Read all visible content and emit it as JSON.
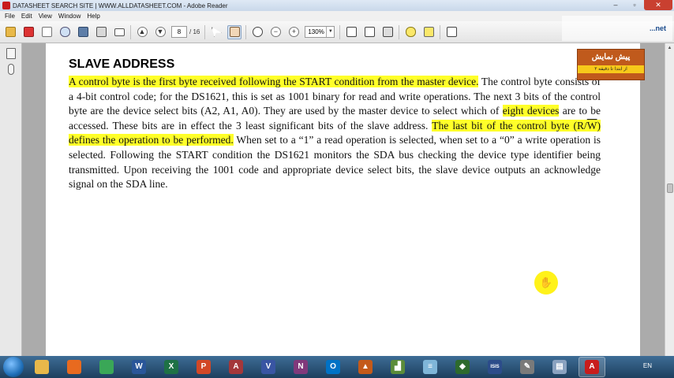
{
  "window": {
    "title": "DATASHEET SEARCH SITE | WWW.ALLDATASHEET.COM - Adobe Reader",
    "minimize": "–",
    "maximize": "▫",
    "close": "✕"
  },
  "menu": [
    "File",
    "Edit",
    "View",
    "Window",
    "Help"
  ],
  "toolbar": {
    "page_current": "8",
    "page_total": "/ 16",
    "zoom": "130%"
  },
  "watermark": {
    "logo_text": "...net",
    "badge_title": "پیش نمایش",
    "badge_sub": "از ابتدا تا دقیقه ۲"
  },
  "document": {
    "heading": "SLAVE ADDRESS",
    "segments": [
      {
        "text": "A control byte is the first byte received following the START condition from the master device.",
        "hl": true
      },
      {
        "text": " The control byte consists of a 4-bit control code; for the DS1621, this is set as 1001 binary for read and write operations.  The next 3 bits of the control byte are the device select bits (A2, A1, A0). They are used by the master device to select which of ",
        "hl": false
      },
      {
        "text": "eight devices",
        "hl": true
      },
      {
        "text": " are to be accessed. These bits are in effect the 3 least significant bits of the slave address. ",
        "hl": false
      },
      {
        "text": "The last bit of the control byte (R/",
        "hl": true
      },
      {
        "text": "W",
        "hl": true,
        "over": true
      },
      {
        "text": ") defines the operation to be performed.",
        "hl": true
      },
      {
        "text": " When set to a “1” a read operation is selected, when set to a “0” a write operation is selected. Following the START condition the DS1621 monitors the SDA bus checking the device type identifier being transmitted.  Upon receiving the 1001 code and appropriate device select bits, the slave device outputs an acknowledge signal on the SDA line.",
        "hl": false
      }
    ]
  },
  "taskbar": {
    "language": "EN",
    "apps": [
      {
        "name": "explorer",
        "label": "",
        "color": "#e8b84a"
      },
      {
        "name": "firefox",
        "label": "",
        "color": "#e86a1f"
      },
      {
        "name": "chrome",
        "label": "",
        "color": "#3aa757"
      },
      {
        "name": "word",
        "label": "W",
        "color": "#2a5699"
      },
      {
        "name": "excel",
        "label": "X",
        "color": "#1e7145"
      },
      {
        "name": "powerpoint",
        "label": "P",
        "color": "#d24726"
      },
      {
        "name": "access",
        "label": "A",
        "color": "#a4373a"
      },
      {
        "name": "visio",
        "label": "V",
        "color": "#3955a3"
      },
      {
        "name": "onenote",
        "label": "N",
        "color": "#80397b"
      },
      {
        "name": "outlook",
        "label": "O",
        "color": "#0072c6"
      },
      {
        "name": "matlab",
        "label": "▲",
        "color": "#c45a1a"
      },
      {
        "name": "chart-app",
        "label": "▟",
        "color": "#5b8c3a"
      },
      {
        "name": "notepad",
        "label": "≡",
        "color": "#7fb6d9"
      },
      {
        "name": "proteus",
        "label": "◆",
        "color": "#2d6a2d"
      },
      {
        "name": "isis",
        "label": "ISIS",
        "color": "#2c4c8a"
      },
      {
        "name": "tool-app",
        "label": "✎",
        "color": "#7a7a7a"
      },
      {
        "name": "document-app",
        "label": "▤",
        "color": "#8aa2c0"
      },
      {
        "name": "adobe-reader",
        "label": "A",
        "color": "#c81c1c"
      }
    ]
  }
}
